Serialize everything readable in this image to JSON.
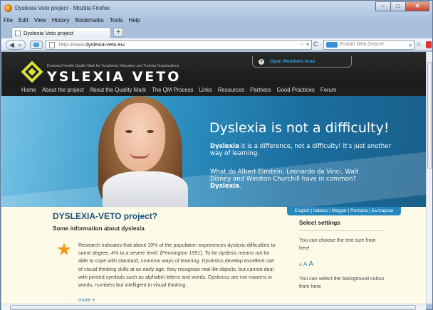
{
  "window": {
    "title": "Dyslexia Veto project - Mozilla Firefox",
    "minimize": "–",
    "maximize": "□",
    "close": "✕"
  },
  "menu": [
    "File",
    "Edit",
    "View",
    "History",
    "Bookmarks",
    "Tools",
    "Help"
  ],
  "tab": {
    "label": "Dyslexia Veto project",
    "new_tab": "+"
  },
  "nav": {
    "back": "◀",
    "forward": "▸",
    "url_prefix": "http://www.",
    "url_domain": "dyslexia-veto.eu",
    "url_suffix": "/",
    "url_right": "☆ ▾",
    "reload": "C",
    "search_placeholder": "Foxtab Web Search",
    "search_icon": "⌕",
    "home_icon": "⌂"
  },
  "site": {
    "tagline": "Dyslexia Friendly Quality Mark for Vocational, Education and Training Organisations",
    "logo": "YSLEXIA VETO",
    "members": "Open Members Area",
    "members_icon": "+",
    "nav": [
      "Home",
      "About the project",
      "About the Quality Mark",
      "The QM Process",
      "Links",
      "Resources",
      "Partners",
      "Good Practices",
      "Forum"
    ]
  },
  "hero": {
    "headline": "Dyslexia is not a difficulty!",
    "p1_bold": "Dyslexia",
    "p1_rest": " it is a difference, not a difficulty! It's just another way of learning.",
    "p2": "What do Albert Einstein, Leonardo da Vinci, Walt Disney and Winston Churchill have in common? ",
    "p2_bold": "Dyslexia",
    "p2_end": "."
  },
  "content": {
    "languages": "English | Italiano | Magyar | Romana | Български",
    "title": "DYSLEXIA-VETO project?",
    "subtitle": "Some information about dyslexia",
    "paragraph": "Research indicates that about 10% of the population experiences dyslexic difficulties to some degree, 4% to a severe level. (Pennington 1991). To be dyslexic means not be able to cope with standard, common ways of learning. Dyslexics develop excellent use of visual thinking skills at an early age, they recognize real life objects, but cannot deal with printed symbols such as alphabet letters and words. Dyslexics are not masters in words, numbers but intelligent in visual thinking.",
    "more": "more +"
  },
  "settings": {
    "heading": "Select settings",
    "text_size_hint": "You can choose the text size from here",
    "size_small": "A",
    "size_medium": "A",
    "size_large": "A",
    "bg_hint": "You can select the background colour from here"
  },
  "colors": {
    "accent": "#2587bd",
    "logo_mark": "#d9df3c",
    "title": "#1b4f7a",
    "content_bg": "#fdfbe8",
    "star": "#f29a1e"
  }
}
